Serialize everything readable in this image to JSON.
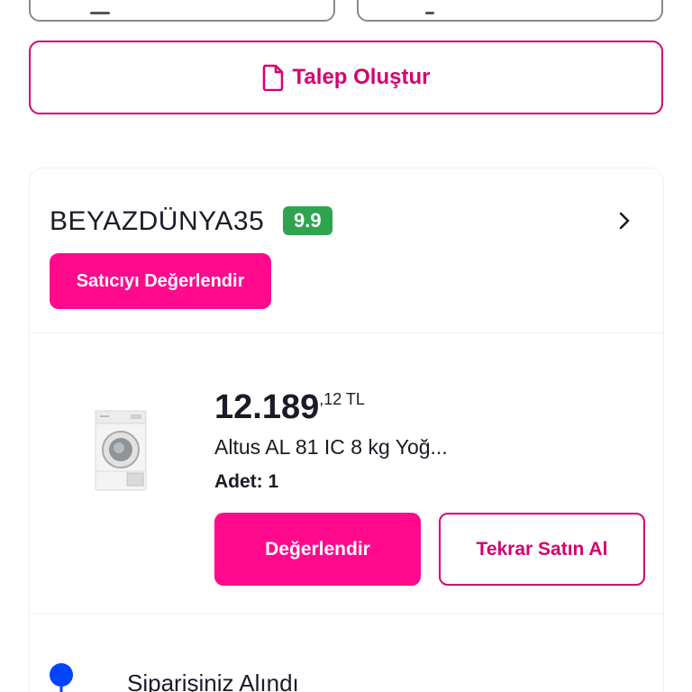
{
  "request_button": {
    "label": "Talep Oluştur",
    "icon": "document-icon"
  },
  "seller": {
    "name": "BEYAZDÜNYA35",
    "score": "9.9",
    "score_color": "#2ea44f",
    "rate_label": "Satıcıyı Değerlendir"
  },
  "product": {
    "price_main": "12.189",
    "price_fraction": ",12 TL",
    "title": "Altus AL 81 IC 8 kg Yoğ...",
    "quantity_label": "Adet:",
    "quantity_value": "1",
    "rate_label": "Değerlendir",
    "rebuy_label": "Tekrar Satın Al"
  },
  "order_status": {
    "label": "Siparişiniz Alındı",
    "icon": "location-pin-icon",
    "color": "#0044ff"
  },
  "colors": {
    "accent": "#ff0a8c",
    "accent_border": "#d6006f"
  }
}
